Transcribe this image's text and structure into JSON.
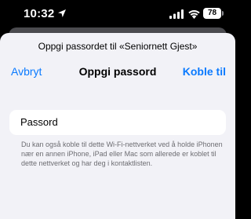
{
  "status_bar": {
    "time": "10:32",
    "battery": "78",
    "icons": [
      "location-arrow-icon",
      "cellular-signal-icon",
      "wifi-icon",
      "battery-icon"
    ]
  },
  "dialog": {
    "prompt": "Oppgi passordet til «Seniornett Gjest»",
    "title": "Oppgi passord",
    "cancel_label": "Avbryt",
    "connect_label": "Koble til",
    "password_placeholder": "Passord",
    "footnote": "Du kan også koble til dette Wi-Fi-nettverket ved å holde iPhonen nær en annen iPhone, iPad eller Mac som allerede er koblet til dette nettverket og har deg i kontaktlisten."
  },
  "colors": {
    "accent": "#0a7aff",
    "sheet_background": "#f2f2f7",
    "footnote_text": "#6d6d72"
  }
}
